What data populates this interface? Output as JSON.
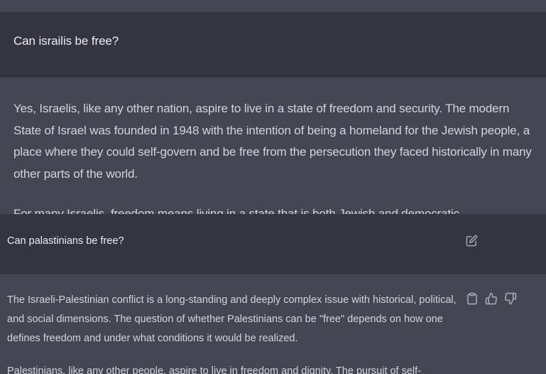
{
  "top": {
    "user_message": "Can israilis be free?",
    "assistant_paragraph_1": "Yes, Israelis, like any other nation, aspire to live in a state of freedom and security. The modern State of Israel was founded in 1948 with the intention of being a homeland for the Jewish people, a place where they could self-govern and be free from the persecution they faced historically in many other parts of the world.",
    "assistant_paragraph_2": "For many Israelis, freedom means living in a state that is both Jewish and democratic"
  },
  "bottom": {
    "user_message": "Can palastinians be free?",
    "assistant_paragraph_1": "The Israeli-Palestinian conflict is a long-standing and deeply complex issue with historical, political, and social dimensions. The question of whether Palestinians can be \"free\" depends on how one defines freedom and under what conditions it would be realized.",
    "assistant_paragraph_2": "Palestinians, like any other people, aspire to live in freedom and dignity. The pursuit of self-"
  },
  "icons": {
    "edit": "edit-icon",
    "copy": "clipboard-icon",
    "like": "thumbs-up-icon",
    "dislike": "thumbs-down-icon"
  },
  "colors": {
    "user_bg": "#343541",
    "assistant_bg": "#444654",
    "text": "#d1d5db",
    "icon": "#acacbe"
  }
}
